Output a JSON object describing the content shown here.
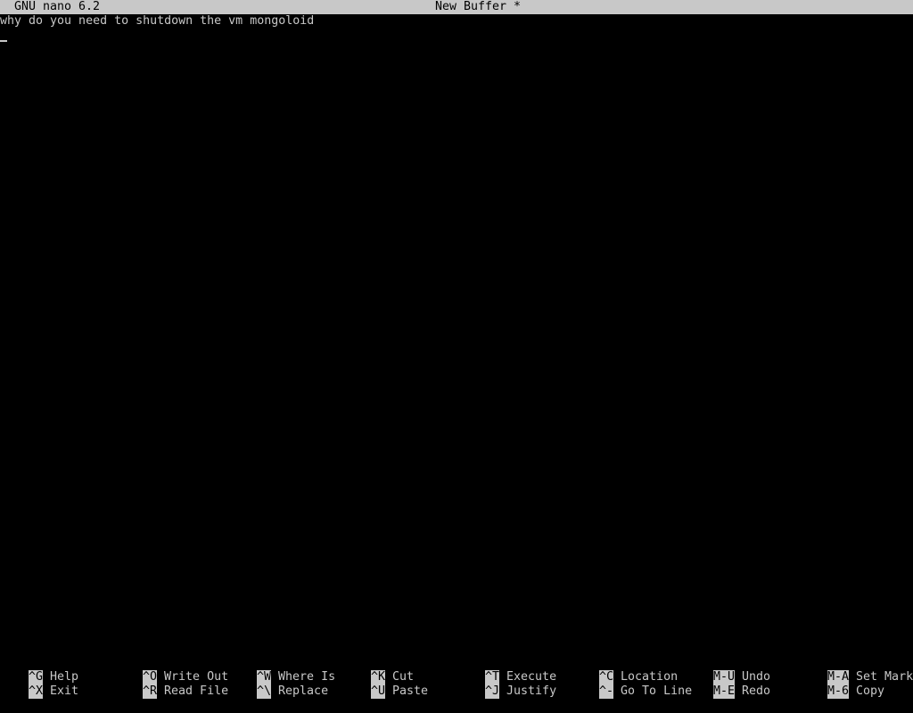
{
  "titlebar": {
    "app": "GNU nano 6.2",
    "buffer": "New Buffer *"
  },
  "editor": {
    "lines": [
      "why do you need to shutdown the vm mongoloid",
      ""
    ]
  },
  "shortcuts": {
    "row1": [
      {
        "key": "^G",
        "label": "Help"
      },
      {
        "key": "^O",
        "label": "Write Out"
      },
      {
        "key": "^W",
        "label": "Where Is"
      },
      {
        "key": "^K",
        "label": "Cut"
      },
      {
        "key": "^T",
        "label": "Execute"
      },
      {
        "key": "^C",
        "label": "Location"
      },
      {
        "key": "M-U",
        "label": "Undo"
      },
      {
        "key": "M-A",
        "label": "Set Mark"
      }
    ],
    "row2": [
      {
        "key": "^X",
        "label": "Exit"
      },
      {
        "key": "^R",
        "label": "Read File"
      },
      {
        "key": "^\\",
        "label": "Replace"
      },
      {
        "key": "^U",
        "label": "Paste"
      },
      {
        "key": "^J",
        "label": "Justify"
      },
      {
        "key": "^-",
        "label": "Go To Line"
      },
      {
        "key": "M-E",
        "label": "Redo"
      },
      {
        "key": "M-6",
        "label": "Copy"
      }
    ]
  }
}
